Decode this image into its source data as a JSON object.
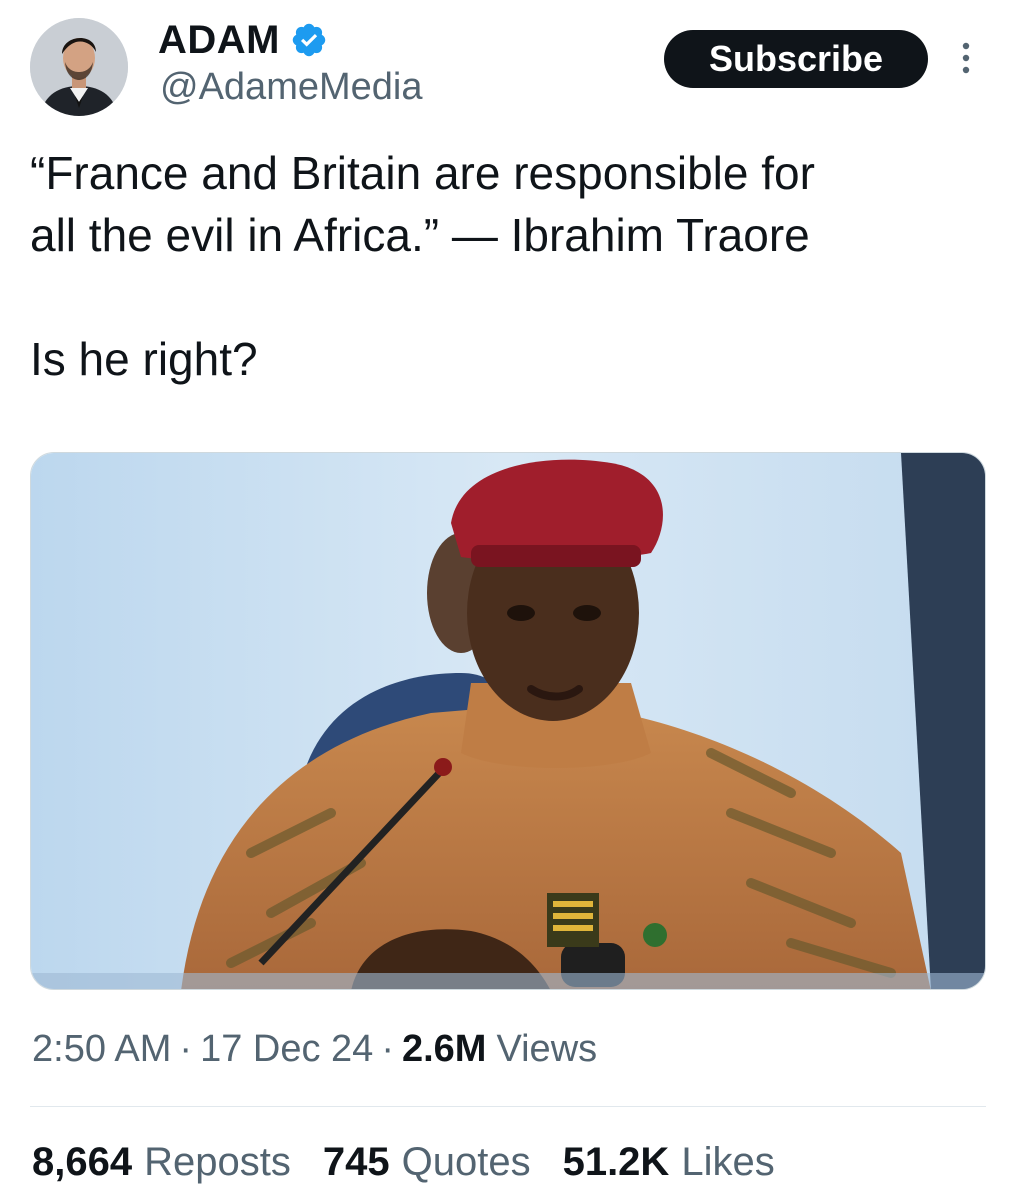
{
  "author": {
    "display_name": "ADAM",
    "handle": "@AdameMedia",
    "avatar_icon": "profile-photo-avatar",
    "verified_color": "#1d9bf0"
  },
  "header": {
    "subscribe_label": "Subscribe",
    "more_icon": "vertical-ellipsis-icon"
  },
  "tweet": {
    "quote_line1": "“France and Britain are responsible for",
    "quote_line2": "all the evil in Africa.” — Ibrahim Traore",
    "question": "Is he right?"
  },
  "media": {
    "type": "photo",
    "subject": "man in camouflage uniform and red beret speaking at microphone"
  },
  "meta": {
    "time": "2:50 AM",
    "date": "17 Dec 24",
    "separator": "·",
    "views_count": "2.6M",
    "views_label": "Views"
  },
  "stats": [
    {
      "count": "8,664",
      "label": "Reposts"
    },
    {
      "count": "745",
      "label": "Quotes"
    },
    {
      "count": "51.2K",
      "label": "Likes"
    }
  ],
  "colors": {
    "text_primary": "#0f1419",
    "text_secondary": "#536471",
    "button_bg": "#0f1419",
    "divider": "#e1e8ed"
  }
}
